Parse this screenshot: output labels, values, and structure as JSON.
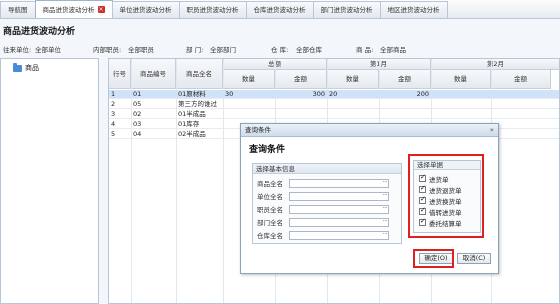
{
  "tabs": [
    {
      "label": "导航图",
      "active": false,
      "closable": false
    },
    {
      "label": "商品进货波动分析",
      "active": true,
      "closable": true
    },
    {
      "label": "单位进货波动分析",
      "active": false,
      "closable": false
    },
    {
      "label": "职员进货波动分析",
      "active": false,
      "closable": false
    },
    {
      "label": "仓库进货波动分析",
      "active": false,
      "closable": false
    },
    {
      "label": "部门进货波动分析",
      "active": false,
      "closable": false
    },
    {
      "label": "地区进货波动分析",
      "active": false,
      "closable": false
    }
  ],
  "page_title": "商品进货波动分析",
  "filters": {
    "unit_label": "往来单位:",
    "unit_value": "全部单位",
    "staff_label": "内部职员:",
    "staff_value": "全部职员",
    "dept_label": "部 门:",
    "dept_value": "全部部门",
    "warehouse_label": "仓 库:",
    "warehouse_value": "全部仓库",
    "product_label": "商 品:",
    "product_value": "全部商品"
  },
  "tree": {
    "root_label": "商品"
  },
  "grid": {
    "headers": {
      "row_no": "行号",
      "code": "商品编号",
      "name": "商品全名",
      "total": "总额",
      "month1": "第1月",
      "month2": "第2月",
      "qty": "数量",
      "amount": "金额"
    },
    "rows": [
      {
        "no": "1",
        "code": "01",
        "name": "01原材料",
        "total_qty": "30",
        "total_amount": "300",
        "m1_qty": "20",
        "m1_amount": "200",
        "selected": true
      },
      {
        "no": "2",
        "code": "05",
        "name": "第三方的谁过",
        "total_qty": "",
        "total_amount": "",
        "m1_qty": "",
        "m1_amount": "",
        "selected": false
      },
      {
        "no": "3",
        "code": "02",
        "name": "01半成品",
        "total_qty": "",
        "total_amount": "",
        "m1_qty": "",
        "m1_amount": "",
        "selected": false
      },
      {
        "no": "4",
        "code": "03",
        "name": "01库存",
        "total_qty": "",
        "total_amount": "",
        "m1_qty": "",
        "m1_amount": "",
        "selected": false
      },
      {
        "no": "5",
        "code": "04",
        "name": "02半成品",
        "total_qty": "",
        "total_amount": "",
        "m1_qty": "",
        "m1_amount": "",
        "selected": false
      }
    ]
  },
  "dialog": {
    "title": "查询条件",
    "close_glyph": "»",
    "heading": "查询条件",
    "basic_info_legend": "选择基本信息",
    "fields": [
      {
        "label": "商品全名",
        "value": ""
      },
      {
        "label": "单位全名",
        "value": ""
      },
      {
        "label": "职员全名",
        "value": ""
      },
      {
        "label": "部门全名",
        "value": ""
      },
      {
        "label": "仓库全名",
        "value": ""
      }
    ],
    "field_button": "···",
    "doc_legend": "选择单据",
    "doc_types": [
      {
        "label": "进货单",
        "checked": true
      },
      {
        "label": "进货退货单",
        "checked": true
      },
      {
        "label": "进货换货单",
        "checked": true
      },
      {
        "label": "借转进货单",
        "checked": true
      },
      {
        "label": "委托结算单",
        "checked": true
      }
    ],
    "ok_label": "确定(O)",
    "cancel_label": "取消(C)"
  },
  "colors": {
    "highlight": "#e02020",
    "selected_row": "#cfe2f7",
    "folder": "#4a8ad6"
  }
}
